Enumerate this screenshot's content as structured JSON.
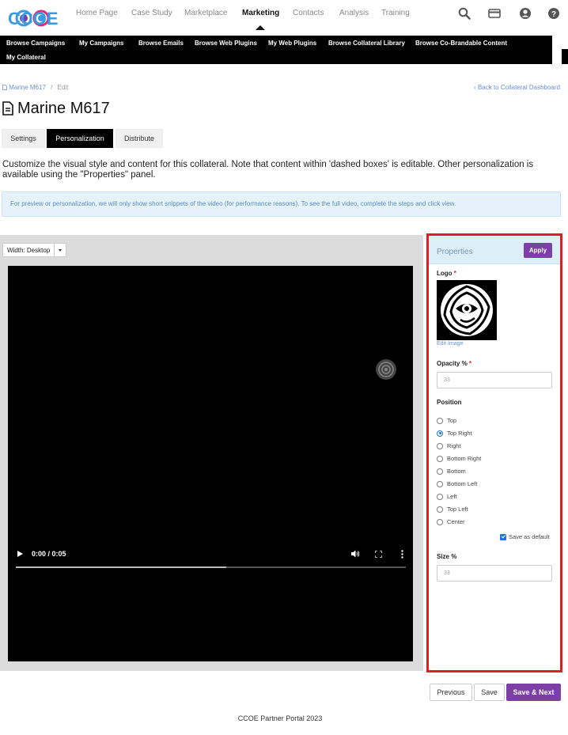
{
  "topnav": {
    "logo_text": "CCOE",
    "items": [
      {
        "label": "Home Page"
      },
      {
        "label": "Case Study"
      },
      {
        "label": "Marketplace"
      },
      {
        "label": "Marketing"
      },
      {
        "label": "Contacts"
      },
      {
        "label": "Analysis"
      },
      {
        "label": "Training"
      }
    ],
    "active": "Marketing",
    "icons": [
      "search-icon",
      "card-icon",
      "user-icon",
      "help-icon"
    ]
  },
  "subnav": {
    "items": [
      {
        "label": "Browse Campaigns"
      },
      {
        "label": "My Campaigns"
      },
      {
        "label": "Browse Emails"
      },
      {
        "label": "Browse Web Plugins"
      },
      {
        "label": "My Web Plugins"
      },
      {
        "label": "Browse Collateral Library"
      },
      {
        "label": "Browse Co-Brandable Content"
      },
      {
        "label": "My Collateral"
      }
    ]
  },
  "breadcrumb": {
    "item": "Marine M617",
    "sep": "/",
    "current": "Edit",
    "back_link": "Back to Collateral Dashboard"
  },
  "page": {
    "title": "Marine M617",
    "tabs": [
      {
        "label": "Settings"
      },
      {
        "label": "Personalization"
      },
      {
        "label": "Distribute"
      }
    ],
    "active_tab": "Personalization",
    "description": "Customize the visual style and content for this collateral. Note that content within 'dashed boxes' is editable. Other personalization is available using the \"Properties\" panel.",
    "alert": "For preview or personalization, we will only show short snippets of the video (for performance reasons). To see the full video, complete the steps and click view."
  },
  "preview": {
    "width_label": "Width: Desktop",
    "video_time": "0:00 / 0:05",
    "video_progress": 0.54
  },
  "properties": {
    "title": "Properties",
    "apply_label": "Apply",
    "logo_label": "Logo",
    "required_mark": "*",
    "edit_image": "Edit Image",
    "opacity_label": "Opacity %",
    "opacity_placeholder": "33",
    "position_label": "Position",
    "positions": [
      {
        "label": "Top",
        "selected": false
      },
      {
        "label": "Top Right",
        "selected": true
      },
      {
        "label": "Right",
        "selected": false
      },
      {
        "label": "Bottom Right",
        "selected": false
      },
      {
        "label": "Bottom",
        "selected": false
      },
      {
        "label": "Bottom Left",
        "selected": false
      },
      {
        "label": "Left",
        "selected": false
      },
      {
        "label": "Top Left",
        "selected": false
      },
      {
        "label": "Center",
        "selected": false
      }
    ],
    "save_default_label": "Save as default",
    "save_default_checked": true,
    "size_label": "Size %",
    "size_placeholder": "33"
  },
  "actions": {
    "previous": "Previous",
    "save": "Save",
    "save_next": "Save & Next"
  },
  "footer": {
    "text": "CCOE Partner Portal 2023"
  },
  "colors": {
    "accent": "#7b3fa6",
    "highlight_border": "#e31b23",
    "link": "#6a8fd8",
    "alert_bg": "#e6f2fa"
  }
}
